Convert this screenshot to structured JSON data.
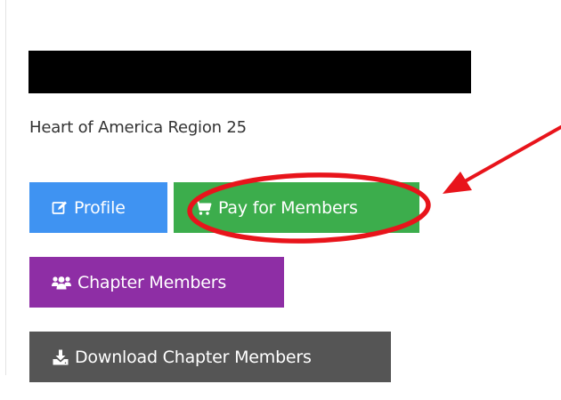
{
  "chapter": {
    "region": "Heart of America Region 25"
  },
  "buttons": {
    "profile": "Profile",
    "pay": "Pay for Members",
    "chapter_members": "Chapter Members",
    "download": "Download Chapter Members"
  },
  "icons": {
    "profile": "edit-icon",
    "pay": "shopping-cart-icon",
    "chapter_members": "users-icon",
    "download": "download-icon"
  },
  "colors": {
    "profile": "#3f93f2",
    "pay": "#3cad4c",
    "chapter_members": "#8e2ea5",
    "download": "#555555",
    "annotation": "#e8141b"
  }
}
